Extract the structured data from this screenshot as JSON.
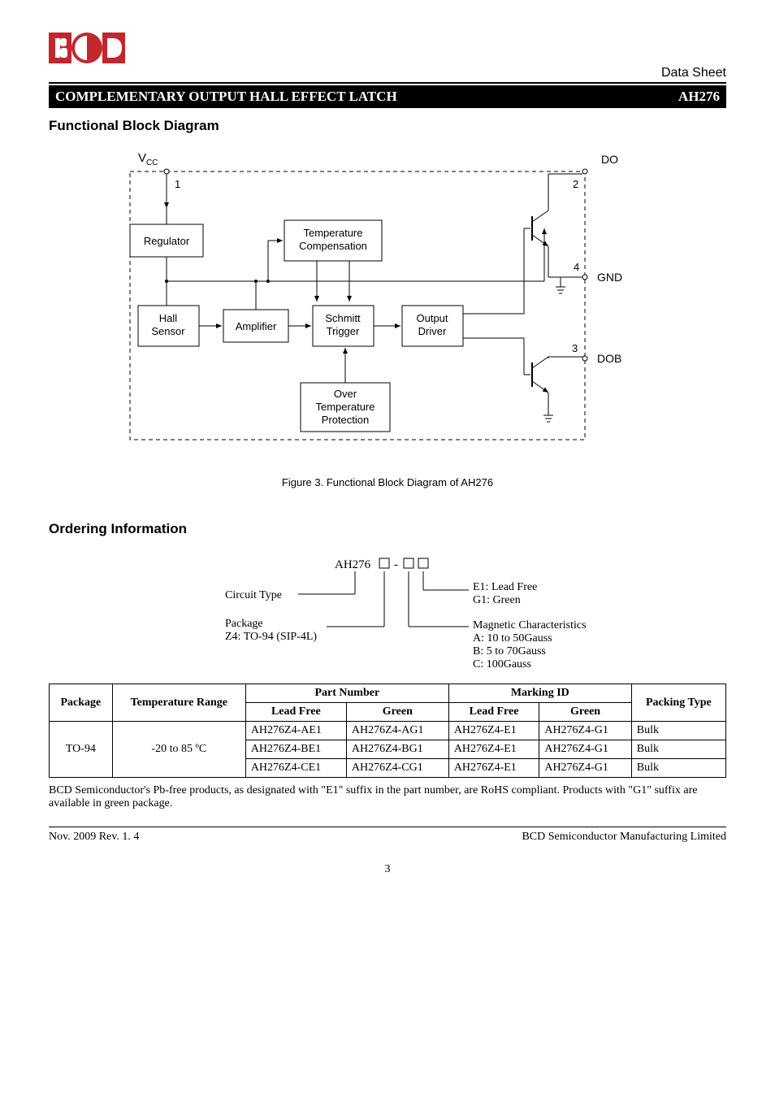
{
  "header": {
    "data_sheet": "Data Sheet",
    "title_left": "COMPLEMENTARY OUTPUT HALL EFFECT LATCH",
    "title_right": "AH276"
  },
  "block_diagram": {
    "section_title": "Functional Block Diagram",
    "caption": "Figure 3. Functional Block Diagram of AH276",
    "labels": {
      "vcc": "V",
      "vcc_sub": "CC",
      "do": "DO",
      "gnd": "GND",
      "dob": "DOB",
      "pin1": "1",
      "pin2": "2",
      "pin3": "3",
      "pin4": "4",
      "regulator": "Regulator",
      "temp_comp1": "Temperature",
      "temp_comp2": "Compensation",
      "hall1": "Hall",
      "hall2": "Sensor",
      "amplifier": "Amplifier",
      "schmitt1": "Schmitt",
      "schmitt2": "Trigger",
      "output1": "Output",
      "output2": "Driver",
      "otp1": "Over",
      "otp2": "Temperature",
      "otp3": "Protection"
    }
  },
  "ordering": {
    "section_title": "Ordering Information",
    "prefix": "AH276",
    "circuit_type": "Circuit Type",
    "package_label": "Package",
    "package_val": "Z4: TO-94 (SIP-4L)",
    "lead_free": "E1: Lead Free",
    "green": "G1: Green",
    "mag_char": "Magnetic Characteristics",
    "mag_a": "A: 10 to 50Gauss",
    "mag_b": "B: 5 to 70Gauss",
    "mag_c": "C: 100Gauss",
    "dash": "-"
  },
  "table": {
    "headers": {
      "package": "Package",
      "temp_range": "Temperature Range",
      "part_number": "Part Number",
      "marking_id": "Marking ID",
      "packing_type": "Packing Type",
      "lead_free": "Lead Free",
      "green": "Green"
    },
    "package": "TO-94",
    "temp_range": "-20 to 85 ºC",
    "rows": [
      {
        "pn_lf": "AH276Z4-AE1",
        "pn_g": "AH276Z4-AG1",
        "mk_lf": "AH276Z4-E1",
        "mk_g": "AH276Z4-G1",
        "pack": "Bulk"
      },
      {
        "pn_lf": "AH276Z4-BE1",
        "pn_g": "AH276Z4-BG1",
        "mk_lf": "AH276Z4-E1",
        "mk_g": "AH276Z4-G1",
        "pack": "Bulk"
      },
      {
        "pn_lf": "AH276Z4-CE1",
        "pn_g": "AH276Z4-CG1",
        "mk_lf": "AH276Z4-E1",
        "mk_g": "AH276Z4-G1",
        "pack": "Bulk"
      }
    ]
  },
  "footnote": "BCD Semiconductor's Pb-free products, as designated with \"E1\" suffix in the part number, are RoHS compliant. Products with \"G1\" suffix are available in green package.",
  "footer": {
    "left": "Nov. 2009  Rev. 1. 4",
    "right": "BCD Semiconductor Manufacturing Limited",
    "page": "3"
  }
}
